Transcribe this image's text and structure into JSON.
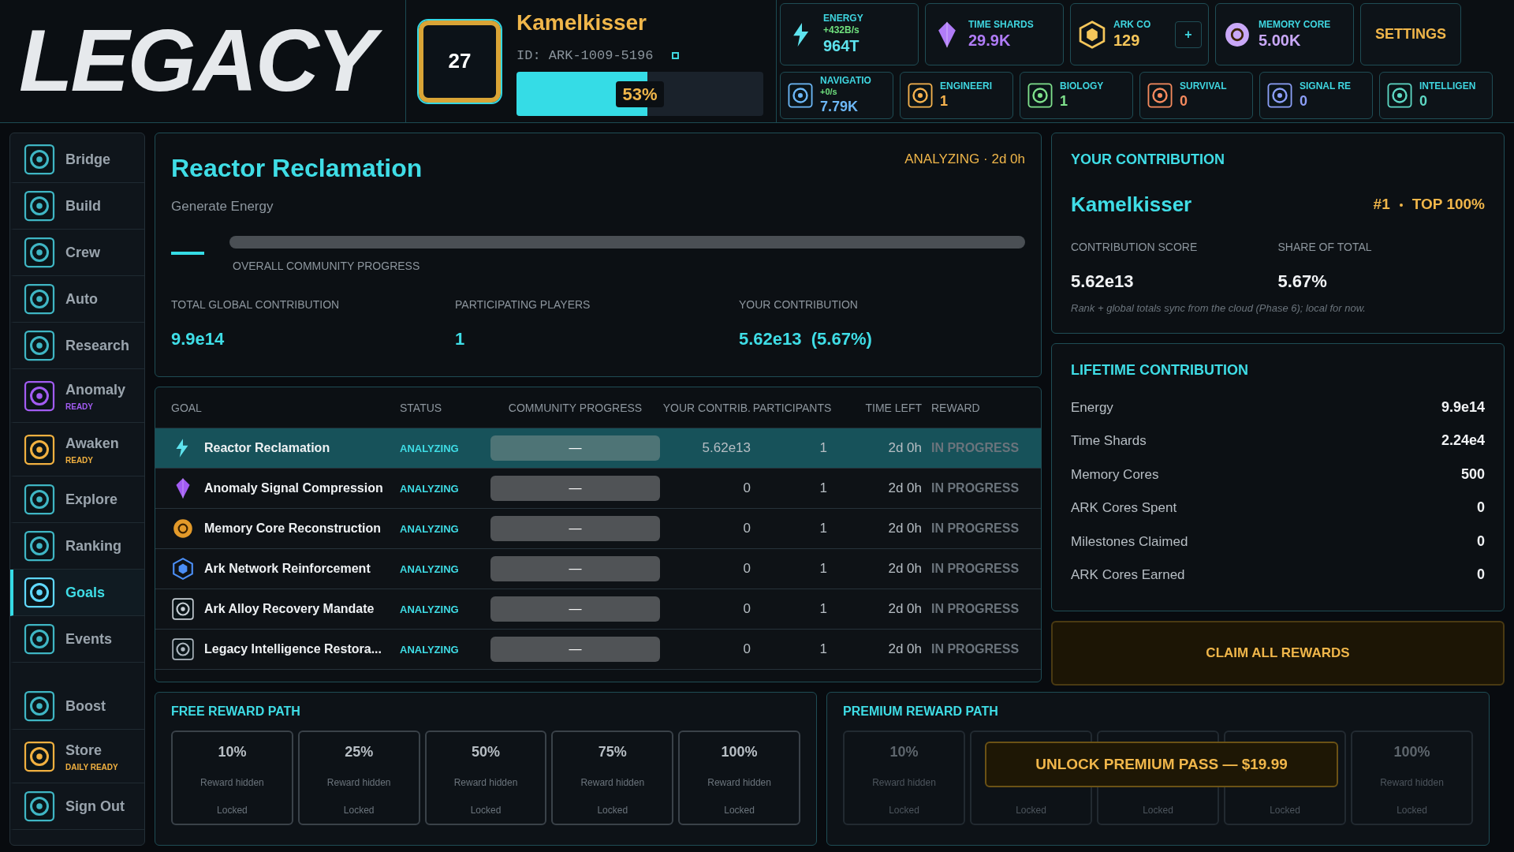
{
  "logo": {
    "title": "LEGACY"
  },
  "profile": {
    "level": "27",
    "name": "Kamelkisser",
    "id": "ID: ARK-1009-5196",
    "xp": {
      "level": 0.53,
      "reading": "53%"
    }
  },
  "resources": [
    {
      "label": "ENERGY",
      "rate": "+432B/s",
      "value": "964T",
      "color": "#5ee3ee"
    },
    {
      "label": "TIME SHARDS",
      "value": "29.9K",
      "color": "#b07cf7"
    },
    {
      "label": "ARK CO",
      "value": "129",
      "color": "#f5c65a",
      "add_button": "+"
    },
    {
      "label": "MEMORY CORE",
      "value": "5.00K",
      "color": "#c9a8f7"
    }
  ],
  "settings_button": "SETTINGS",
  "skills": [
    {
      "label": "NAVIGATIO",
      "rate": "+0/s",
      "value": "7.79K",
      "color": "#6db8f7"
    },
    {
      "label": "ENGINEERI",
      "value": "1",
      "color": "#f5b24e"
    },
    {
      "label": "BIOLOGY",
      "value": "1",
      "color": "#7fe08c"
    },
    {
      "label": "SURVIVAL",
      "value": "0",
      "color": "#f58a5e"
    },
    {
      "label": "SIGNAL RE",
      "value": "0",
      "color": "#8c9ff7"
    },
    {
      "label": "INTELLIGEN",
      "value": "0",
      "color": "#5ed8c4"
    }
  ],
  "sidebar": {
    "items": [
      {
        "label": "Bridge",
        "selected": false
      },
      {
        "label": "Build",
        "selected": false
      },
      {
        "label": "Crew",
        "selected": false
      },
      {
        "label": "Auto",
        "selected": false
      },
      {
        "label": "Research",
        "selected": false
      },
      {
        "label": "Anomaly",
        "selected": false,
        "badge": "READY",
        "color": "#a25cf2"
      },
      {
        "label": "Awaken",
        "selected": false,
        "badge": "READY",
        "color": "#f0b040"
      },
      {
        "label": "Explore",
        "selected": false
      },
      {
        "label": "Ranking",
        "selected": false
      },
      {
        "label": "Goals",
        "selected": true
      },
      {
        "label": "Events",
        "selected": false
      },
      {
        "label": "Boost",
        "selected": false,
        "gap_before": true
      },
      {
        "label": "Store",
        "selected": false,
        "badge": "DAILY READY",
        "color": "#f0b040"
      },
      {
        "label": "Sign Out",
        "selected": false
      }
    ]
  },
  "goal_header": {
    "title": "Reactor Reclamation",
    "subtitle": "Generate Energy",
    "status": "ANALYZING · 2d 0h",
    "progress_label": "OVERALL COMMUNITY PROGRESS",
    "stats": [
      {
        "label": "TOTAL GLOBAL CONTRIBUTION",
        "value": "9.9e14"
      },
      {
        "label": "PARTICIPATING PLAYERS",
        "value": "1"
      },
      {
        "label": "YOUR CONTRIBUTION",
        "value": "5.62e13  (5.67%)"
      }
    ]
  },
  "table": {
    "columns": [
      "GOAL",
      "STATUS",
      "COMMUNITY PROGRESS",
      "YOUR CONTRIB.",
      "PARTICIPANTS",
      "TIME LEFT",
      "REWARD"
    ],
    "rows": [
      {
        "goal": "Reactor Reclamation",
        "status": "ANALYZING",
        "progress": "—",
        "contrib": "5.62e13",
        "participants": "1",
        "time_left": "2d 0h",
        "reward": "IN PROGRESS",
        "selected": true
      },
      {
        "goal": "Anomaly Signal Compression",
        "status": "ANALYZING",
        "progress": "—",
        "contrib": "0",
        "participants": "1",
        "time_left": "2d 0h",
        "reward": "IN PROGRESS",
        "selected": false
      },
      {
        "goal": "Memory Core Reconstruction",
        "status": "ANALYZING",
        "progress": "—",
        "contrib": "0",
        "participants": "1",
        "time_left": "2d 0h",
        "reward": "IN PROGRESS",
        "selected": false
      },
      {
        "goal": "Ark Network Reinforcement",
        "status": "ANALYZING",
        "progress": "—",
        "contrib": "0",
        "participants": "1",
        "time_left": "2d 0h",
        "reward": "IN PROGRESS",
        "selected": false
      },
      {
        "goal": "Ark Alloy Recovery Mandate",
        "status": "ANALYZING",
        "progress": "—",
        "contrib": "0",
        "participants": "1",
        "time_left": "2d 0h",
        "reward": "IN PROGRESS",
        "selected": false
      },
      {
        "goal": "Legacy Intelligence Restora...",
        "status": "ANALYZING",
        "progress": "—",
        "contrib": "0",
        "participants": "1",
        "time_left": "2d 0h",
        "reward": "IN PROGRESS",
        "selected": false
      }
    ]
  },
  "your_contribution": {
    "title": "YOUR CONTRIBUTION",
    "name": "Kamelkisser",
    "rank": "#1",
    "top": "TOP 100%",
    "stats": [
      {
        "label": "CONTRIBUTION SCORE",
        "value": "5.62e13"
      },
      {
        "label": "SHARE OF TOTAL",
        "value": "5.67%"
      }
    ],
    "note": "Rank + global totals sync from the cloud (Phase 6); local for now."
  },
  "lifetime": {
    "title": "LIFETIME CONTRIBUTION",
    "rows": [
      {
        "label": "Energy",
        "value": "9.9e14"
      },
      {
        "label": "Time Shards",
        "value": "2.24e4"
      },
      {
        "label": "Memory Cores",
        "value": "500"
      },
      {
        "label": "ARK Cores Spent",
        "value": "0"
      },
      {
        "label": "Milestones Claimed",
        "value": "0"
      },
      {
        "label": "ARK Cores Earned",
        "value": "0"
      }
    ]
  },
  "claim_button": "CLAIM ALL REWARDS",
  "free_path": {
    "title": "FREE REWARD PATH",
    "tiers": [
      {
        "percent": "10%",
        "reward": "Reward hidden",
        "state": "Locked"
      },
      {
        "percent": "25%",
        "reward": "Reward hidden",
        "state": "Locked"
      },
      {
        "percent": "50%",
        "reward": "Reward hidden",
        "state": "Locked"
      },
      {
        "percent": "75%",
        "reward": "Reward hidden",
        "state": "Locked"
      },
      {
        "percent": "100%",
        "reward": "Reward hidden",
        "state": "Locked"
      }
    ]
  },
  "premium_path": {
    "title": "PREMIUM REWARD PATH",
    "unlock_button": "UNLOCK PREMIUM PASS — $19.99",
    "tiers": [
      {
        "percent": "10%",
        "reward": "Reward hidden",
        "state": "Locked"
      },
      {
        "state": "Locked"
      },
      {
        "state": "Locked"
      },
      {
        "state": "Locked"
      },
      {
        "percent": "100%",
        "reward": "Reward hidden",
        "state": "Locked"
      }
    ]
  }
}
